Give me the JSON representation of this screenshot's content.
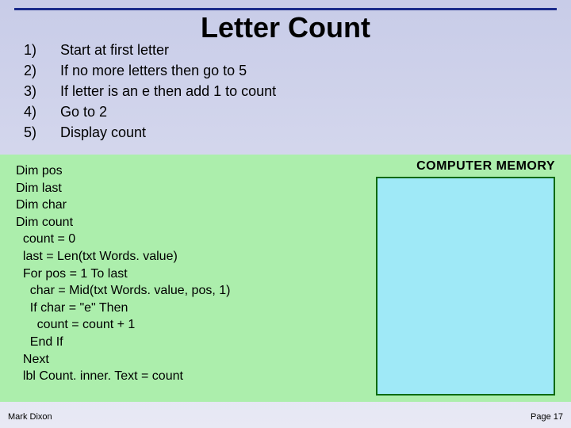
{
  "title": "Letter Count",
  "steps": [
    {
      "n": "1)",
      "text": "Start at first letter"
    },
    {
      "n": "2)",
      "text": "If no more letters then go to 5"
    },
    {
      "n": "3)",
      "text": "If letter is an e then add 1 to count"
    },
    {
      "n": "4)",
      "text": "Go to 2"
    },
    {
      "n": "5)",
      "text": "Display count"
    }
  ],
  "memory_label": "COMPUTER MEMORY",
  "code": "Dim pos\nDim last\nDim char\nDim count\n  count = 0\n  last = Len(txt Words. value)\n  For pos = 1 To last\n    char = Mid(txt Words. value, pos, 1)\n    If char = \"e\" Then\n      count = count + 1\n    End If\n  Next\n  lbl Count. inner. Text = count",
  "footer": {
    "author": "Mark Dixon",
    "page": "Page 17"
  }
}
